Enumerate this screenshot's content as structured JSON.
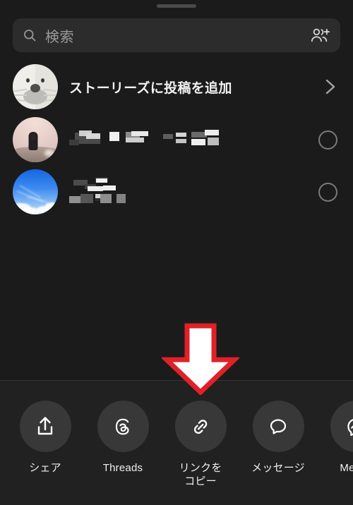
{
  "app": {
    "sheet_title": "",
    "background_color": "#1b1b1b",
    "tray_color": "#212121",
    "accent_color": "#e02128"
  },
  "handle": {
    "name": "sheet-drag-handle"
  },
  "search": {
    "placeholder": "検索",
    "value": "",
    "icon": "search-icon",
    "action_icon": "add-people-icon"
  },
  "story_row": {
    "label": "ストーリーズに投稿を追加",
    "avatar_icon": "seal-avatar",
    "chevron_icon": "chevron-right-icon"
  },
  "contacts": [
    {
      "name_redacted": true,
      "name_lines": 1,
      "avatar_icon": "photo-avatar-person-sunset",
      "selected": false,
      "selector_icon": "unselected-circle-icon"
    },
    {
      "name_redacted": true,
      "name_lines": 2,
      "avatar_icon": "photo-avatar-blue-sky",
      "selected": false,
      "selector_icon": "unselected-circle-icon"
    }
  ],
  "share_tray": {
    "items": [
      {
        "label": "シェア",
        "icon": "share-upload-icon"
      },
      {
        "label": "Threads",
        "icon": "threads-logo-icon"
      },
      {
        "label": "リンクを\nコピー",
        "icon": "link-chain-icon"
      },
      {
        "label": "メッセージ",
        "icon": "message-bubble-icon"
      },
      {
        "label": "Messe",
        "icon": "messenger-logo-icon"
      }
    ]
  },
  "annotation": {
    "arrow_icon": "red-outlined-down-arrow",
    "arrow_fill": "#ffffff",
    "arrow_stroke": "#e02128",
    "points_to": "リンクをコピー"
  }
}
